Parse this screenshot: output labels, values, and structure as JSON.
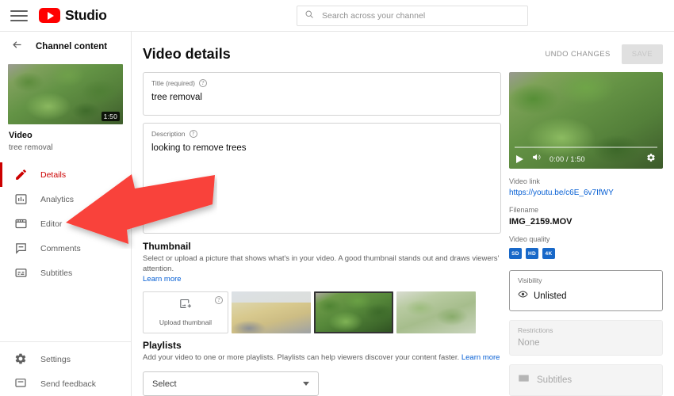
{
  "topbar": {
    "menu_icon": "hamburger-icon",
    "logo_icon": "youtube-play-icon",
    "brand": "Studio",
    "search": {
      "icon": "search-icon",
      "placeholder": "Search across your channel",
      "value": ""
    }
  },
  "sidebar": {
    "back_icon": "arrow-left-icon",
    "back_label": "Channel content",
    "video": {
      "duration": "1:50",
      "type_label": "Video",
      "title": "tree removal"
    },
    "items": [
      {
        "label": "Details",
        "icon": "pencil-icon",
        "active": true
      },
      {
        "label": "Analytics",
        "icon": "bar-chart-icon",
        "active": false
      },
      {
        "label": "Editor",
        "icon": "film-icon",
        "active": false
      },
      {
        "label": "Comments",
        "icon": "comment-icon",
        "active": false
      },
      {
        "label": "Subtitles",
        "icon": "subtitles-icon",
        "active": false
      }
    ],
    "bottom_items": [
      {
        "label": "Settings",
        "icon": "gear-icon"
      },
      {
        "label": "Send feedback",
        "icon": "feedback-icon"
      }
    ]
  },
  "main": {
    "title": "Video details",
    "undo_label": "UNDO CHANGES",
    "save_label": "SAVE",
    "save_disabled": true,
    "title_field": {
      "label": "Title (required)",
      "help_icon": "help-circle-icon",
      "value": "tree removal"
    },
    "description_field": {
      "label": "Description",
      "help_icon": "help-circle-icon",
      "value": "looking to remove trees"
    },
    "thumbnail": {
      "heading": "Thumbnail",
      "description": "Select or upload a picture that shows what's in your video. A good thumbnail stands out and draws viewers' attention.",
      "learn_more": "Learn more",
      "upload_label": "Upload thumbnail",
      "upload_icon": "image-add-icon",
      "help_icon": "help-circle-icon",
      "options": [
        {
          "name": "thumbnail-option-1",
          "style": "tile-house",
          "selected": false
        },
        {
          "name": "thumbnail-option-2",
          "style": "tile-green",
          "selected": true
        },
        {
          "name": "thumbnail-option-3",
          "style": "tile-bush",
          "selected": false
        }
      ]
    },
    "playlists": {
      "heading": "Playlists",
      "description": "Add your video to one or more playlists. Playlists can help viewers discover your content faster.",
      "learn_more": "Learn more",
      "select_value": "Select",
      "caret_icon": "chevron-down-icon"
    }
  },
  "right_panel": {
    "player": {
      "play_icon": "play-icon",
      "volume_icon": "volume-icon",
      "time": "0:00 / 1:50",
      "settings_icon": "gear-icon"
    },
    "video_link": {
      "label": "Video link",
      "value": "https://youtu.be/c6E_6v7IfWY"
    },
    "filename": {
      "label": "Filename",
      "value": "IMG_2159.MOV"
    },
    "video_quality": {
      "label": "Video quality",
      "badges": [
        "SD",
        "HD",
        "4K"
      ]
    },
    "visibility": {
      "label": "Visibility",
      "icon": "eye-icon",
      "value": "Unlisted"
    },
    "restrictions": {
      "label": "Restrictions",
      "value": "None"
    },
    "subtitles": {
      "icon": "subtitles-icon",
      "label": "Subtitles"
    }
  },
  "annotation": {
    "arrow_icon": "red-arrow-left",
    "color": "#f9423a",
    "points_at": "sidebar-item-editor"
  },
  "colors": {
    "brand_red": "#ff0000",
    "active_red": "#cc0000",
    "link_blue": "#065fd4",
    "quality_blue": "#1868c8",
    "annotation_red": "#f9423a"
  }
}
